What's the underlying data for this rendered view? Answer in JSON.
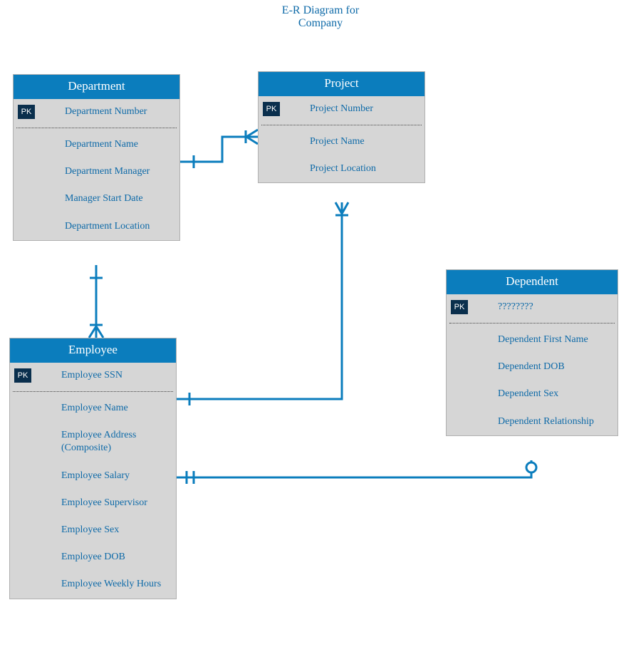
{
  "title": {
    "line1": "E-R Diagram for",
    "line2": "Company"
  },
  "pk_label": "PK",
  "entities": {
    "department": {
      "name": "Department",
      "pk": "Department Number",
      "attrs": [
        "Department Name",
        "Department Manager",
        "Manager Start Date",
        "Department Location"
      ]
    },
    "project": {
      "name": "Project",
      "pk": "Project Number",
      "attrs": [
        "Project Name",
        "Project Location"
      ]
    },
    "employee": {
      "name": "Employee",
      "pk": "Employee SSN",
      "attrs": [
        "Employee Name",
        "Employee Address (Composite)",
        "Employee Salary",
        "Employee Supervisor",
        "Employee Sex",
        "Employee DOB",
        "Employee Weekly Hours"
      ]
    },
    "dependent": {
      "name": "Dependent",
      "pk": "????????",
      "attrs": [
        "Dependent First Name",
        "Dependent DOB",
        "Dependent Sex",
        "Dependent Relationship"
      ]
    }
  },
  "relationships": [
    {
      "from": "Department",
      "to": "Project",
      "type": "one-to-many (crow's foot towards Project)"
    },
    {
      "from": "Department",
      "to": "Employee",
      "type": "one-to-many (crow's foot towards Employee)"
    },
    {
      "from": "Employee",
      "to": "Project",
      "type": "one-to-many, line from Employee to Project bottom"
    },
    {
      "from": "Employee",
      "to": "Dependent",
      "type": "one-to-optional-many (crow's foot + circle towards Dependent)"
    }
  ],
  "colors": {
    "brand": "#0b7dbd",
    "link": "#0e6aa8",
    "body": "#d6d6d6"
  }
}
